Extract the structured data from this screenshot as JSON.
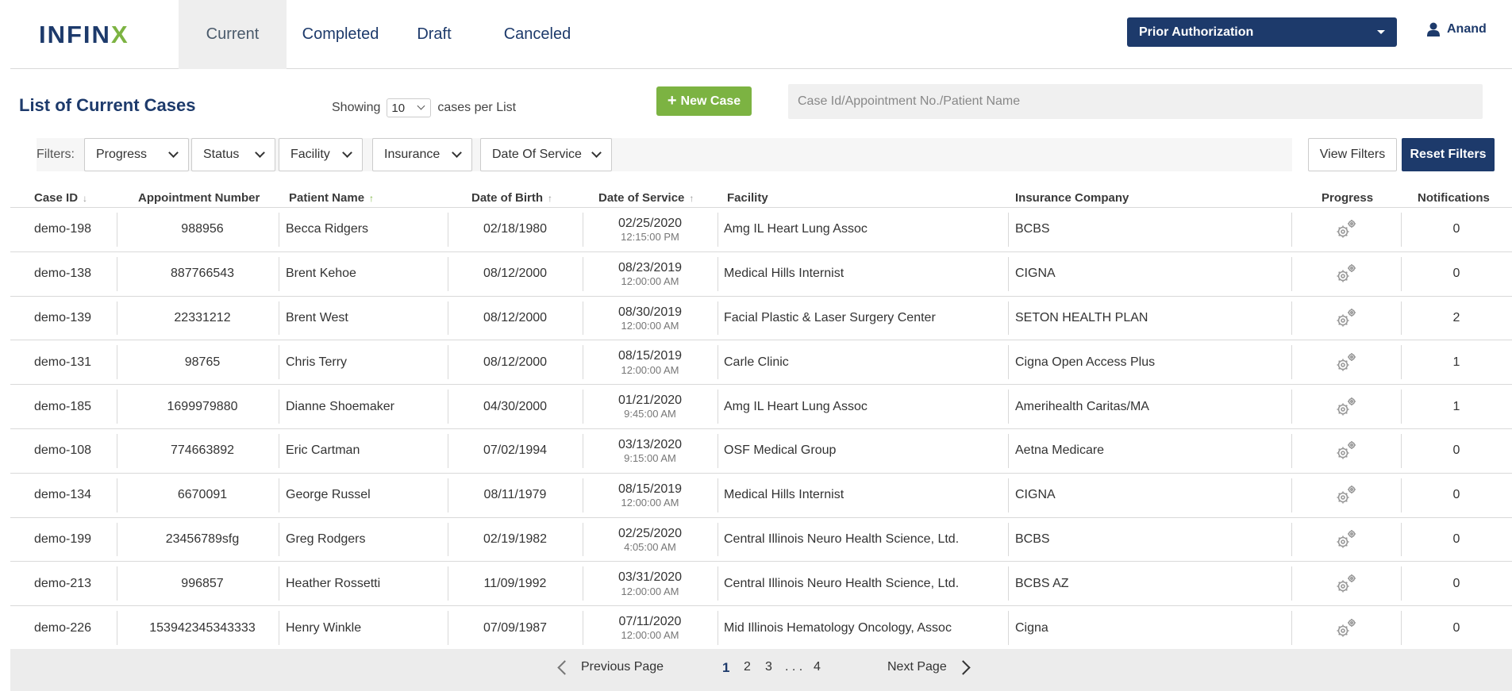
{
  "brand": {
    "logo_main": "INFIN",
    "logo_accent": "X"
  },
  "tabs": [
    {
      "label": "Current",
      "active": true
    },
    {
      "label": "Completed",
      "active": false
    },
    {
      "label": "Draft",
      "active": false
    },
    {
      "label": "Canceled",
      "active": false
    }
  ],
  "module_select": {
    "value": "Prior Authorization"
  },
  "user": {
    "name": "Anand"
  },
  "page": {
    "title": "List of Current Cases",
    "showing_label": "Showing",
    "per_page": "10",
    "per_page_suffix": "cases per List",
    "new_case_label": "New Case",
    "search_placeholder": "Case Id/Appointment No./Patient Name"
  },
  "filters": {
    "label": "Filters:",
    "buttons": [
      "Progress",
      "Status",
      "Facility",
      "Insurance",
      "Date Of Service"
    ],
    "view_label": "View Filters",
    "reset_label": "Reset Filters"
  },
  "table": {
    "columns": {
      "case_id": "Case ID",
      "appointment": "Appointment Number",
      "patient": "Patient Name",
      "dob": "Date of Birth",
      "dos": "Date of Service",
      "facility": "Facility",
      "insurance": "Insurance Company",
      "progress": "Progress",
      "notifications": "Notifications"
    },
    "rows": [
      {
        "case_id": "demo-198",
        "appointment": "988956",
        "patient": "Becca Ridgers",
        "dob": "02/18/1980",
        "dos_date": "02/25/2020",
        "dos_time": "12:15:00 PM",
        "facility": "Amg IL Heart Lung Assoc",
        "insurance": "BCBS",
        "notifications": "0"
      },
      {
        "case_id": "demo-138",
        "appointment": "887766543",
        "patient": "Brent Kehoe",
        "dob": "08/12/2000",
        "dos_date": "08/23/2019",
        "dos_time": "12:00:00 AM",
        "facility": "Medical Hills Internist",
        "insurance": "CIGNA",
        "notifications": "0"
      },
      {
        "case_id": "demo-139",
        "appointment": "22331212",
        "patient": "Brent West",
        "dob": "08/12/2000",
        "dos_date": "08/30/2019",
        "dos_time": "12:00:00 AM",
        "facility": "Facial Plastic & Laser Surgery Center",
        "insurance": "SETON HEALTH PLAN",
        "notifications": "2"
      },
      {
        "case_id": "demo-131",
        "appointment": "98765",
        "patient": "Chris Terry",
        "dob": "08/12/2000",
        "dos_date": "08/15/2019",
        "dos_time": "12:00:00 AM",
        "facility": "Carle Clinic",
        "insurance": "Cigna Open Access Plus",
        "notifications": "1"
      },
      {
        "case_id": "demo-185",
        "appointment": "1699979880",
        "patient": "Dianne Shoemaker",
        "dob": "04/30/2000",
        "dos_date": "01/21/2020",
        "dos_time": "9:45:00 AM",
        "facility": "Amg IL Heart Lung Assoc",
        "insurance": "Amerihealth Caritas/MA",
        "notifications": "1"
      },
      {
        "case_id": "demo-108",
        "appointment": "774663892",
        "patient": "Eric Cartman",
        "dob": "07/02/1994",
        "dos_date": "03/13/2020",
        "dos_time": "9:15:00 AM",
        "facility": "OSF Medical Group",
        "insurance": "Aetna Medicare",
        "notifications": "0"
      },
      {
        "case_id": "demo-134",
        "appointment": "6670091",
        "patient": "George Russel",
        "dob": "08/11/1979",
        "dos_date": "08/15/2019",
        "dos_time": "12:00:00 AM",
        "facility": "Medical Hills Internist",
        "insurance": "CIGNA",
        "notifications": "0"
      },
      {
        "case_id": "demo-199",
        "appointment": "23456789sfg",
        "patient": "Greg Rodgers",
        "dob": "02/19/1982",
        "dos_date": "02/25/2020",
        "dos_time": "4:05:00 AM",
        "facility": "Central Illinois Neuro Health Science, Ltd.",
        "insurance": "BCBS",
        "notifications": "0"
      },
      {
        "case_id": "demo-213",
        "appointment": "996857",
        "patient": "Heather Rossetti",
        "dob": "11/09/1992",
        "dos_date": "03/31/2020",
        "dos_time": "12:00:00 AM",
        "facility": "Central Illinois Neuro Health Science, Ltd.",
        "insurance": "BCBS AZ",
        "notifications": "0"
      },
      {
        "case_id": "demo-226",
        "appointment": "153942345343333",
        "patient": "Henry Winkle",
        "dob": "07/09/1987",
        "dos_date": "07/11/2020",
        "dos_time": "12:00:00 AM",
        "facility": "Mid Illinois Hematology Oncology, Assoc",
        "insurance": "Cigna",
        "notifications": "0"
      }
    ]
  },
  "pagination": {
    "prev_label": "Previous Page",
    "next_label": "Next Page",
    "pages": [
      "1",
      "2",
      "3",
      "4"
    ],
    "ellipsis": ". . .",
    "current": "1"
  },
  "colors": {
    "brand_navy": "#1d3a6b",
    "brand_green": "#7cb342"
  }
}
